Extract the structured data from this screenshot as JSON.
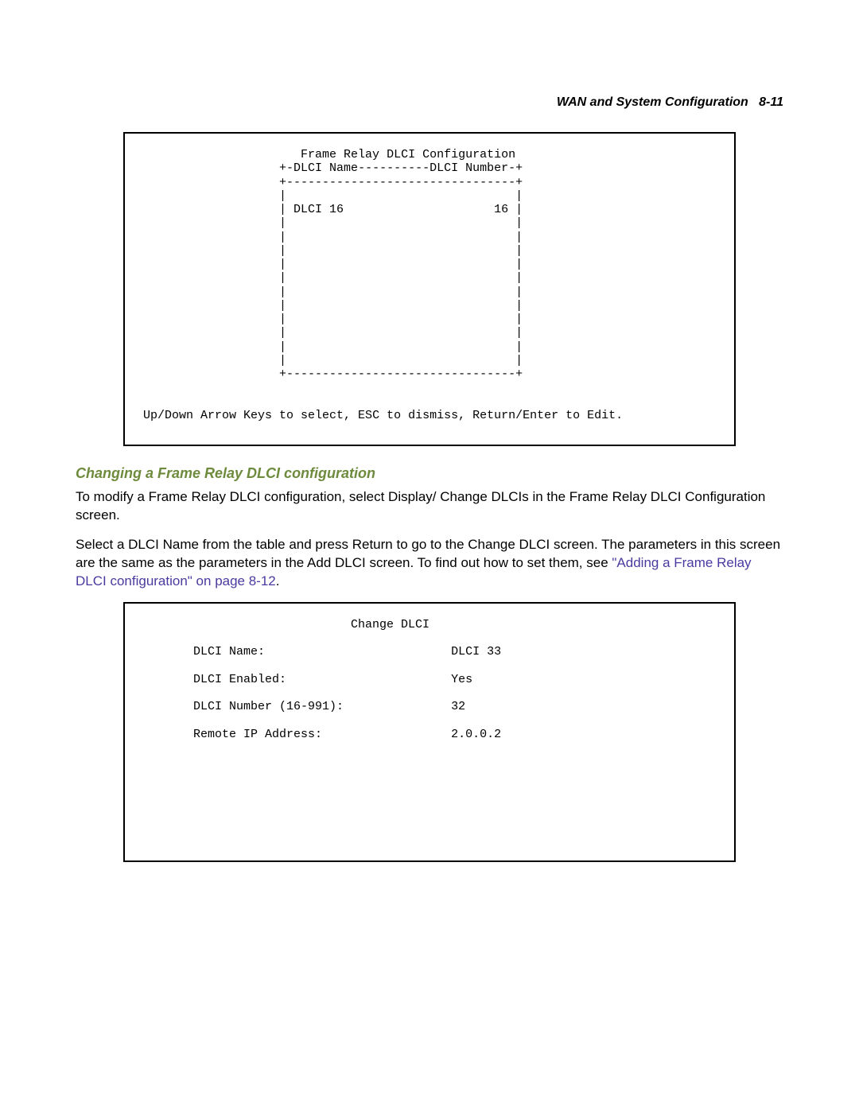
{
  "header": {
    "chapter_title": "WAN and System Configuration",
    "page_ref": "8-11"
  },
  "terminal1": {
    "title": "Frame Relay DLCI Configuration",
    "col_left": "DLCI Name",
    "col_right": "DLCI Number",
    "row_name": "DLCI 16",
    "row_number": "16",
    "hint": "Up/Down Arrow Keys to select, ESC to dismiss, Return/Enter to Edit."
  },
  "section": {
    "heading": "Changing a Frame Relay DLCI configuration",
    "p1": "To modify a Frame Relay DLCI configuration, select Display/ Change DLCIs in the Frame Relay DLCI Configuration screen.",
    "p2a": "Select a DLCI Name from the table and press Return to go to the Change DLCI screen. The parameters in this screen are the same as the parameters in the Add DLCI screen. To find out how to set them, see ",
    "p2_link": "\"Adding a Frame Relay DLCI configuration\" on page 8-12",
    "p2b": "."
  },
  "terminal2": {
    "title": "Change DLCI",
    "fields": {
      "name_label": "DLCI Name:",
      "name_value": "DLCI 33",
      "enabled_label": "DLCI Enabled:",
      "enabled_value": "Yes",
      "number_label": "DLCI Number (16-991):",
      "number_value": "32",
      "remote_label": "Remote IP Address:",
      "remote_value": "2.0.0.2"
    }
  }
}
